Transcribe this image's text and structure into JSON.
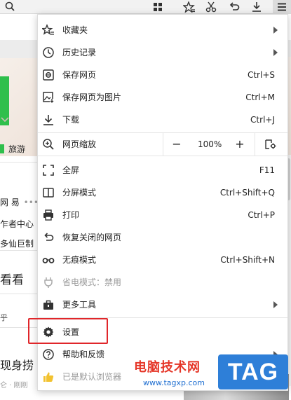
{
  "toolbar": {
    "icons": [
      "search-icon",
      "extensions-grid-icon",
      "bookmark-star-icon",
      "cut-icon",
      "undo-icon",
      "download-icon",
      "menu-icon"
    ]
  },
  "background_page": {
    "tag_travel": "旅游",
    "netease": "网 易",
    "netease_more": "•••",
    "author_center": "乍者中心",
    "line_4": "多仙巨制",
    "line_5": "看看",
    "tab_1": "乎",
    "tab_2": "财",
    "headline": "现身捞",
    "meta": "仑 · 刚刚"
  },
  "menu": {
    "items": [
      {
        "id": "favorites",
        "label": "收藏夹",
        "icon": "star-list-icon",
        "submenu": true
      },
      {
        "id": "history",
        "label": "历史记录",
        "icon": "clock-icon",
        "submenu": true
      },
      {
        "id": "save-page",
        "label": "保存网页",
        "icon": "save-page-icon",
        "shortcut": "Ctrl+S"
      },
      {
        "id": "save-as-image",
        "label": "保存网页为图片",
        "icon": "image-save-icon",
        "shortcut": "Ctrl+M"
      },
      {
        "id": "download",
        "label": "下载",
        "icon": "download-icon",
        "shortcut": "Ctrl+J"
      },
      {
        "id": "fullscreen",
        "label": "全屏",
        "icon": "fullscreen-icon",
        "shortcut": "F11"
      },
      {
        "id": "split-screen",
        "label": "分屏模式",
        "icon": "split-screen-icon",
        "shortcut": "Ctrl+Shift+Q"
      },
      {
        "id": "print",
        "label": "打印",
        "icon": "printer-icon",
        "shortcut": "Ctrl+P"
      },
      {
        "id": "restore-closed",
        "label": "恢复关闭的网页",
        "icon": "restore-icon"
      },
      {
        "id": "incognito",
        "label": "无痕模式",
        "icon": "incognito-icon",
        "shortcut": "Ctrl+Shift+N"
      },
      {
        "id": "power-saving",
        "label": "省电模式：禁用",
        "icon": "plug-icon",
        "disabled": true
      },
      {
        "id": "more-tools",
        "label": "更多工具",
        "icon": "toolbox-icon",
        "submenu": true
      },
      {
        "id": "settings",
        "label": "设置",
        "icon": "gear-icon",
        "highlighted": true
      },
      {
        "id": "help-feedback",
        "label": "帮助和反馈",
        "icon": "help-icon",
        "submenu": true
      },
      {
        "id": "default-browser",
        "label": "已是默认浏览器",
        "icon": "thumbs-up-icon",
        "disabled": true
      }
    ],
    "zoom": {
      "label": "网页缩放",
      "icon": "zoom-icon",
      "minus": "−",
      "value": "100%",
      "plus": "+",
      "settings_icon": "zoom-settings-icon"
    }
  },
  "watermark": {
    "site_name": "电脑技术网",
    "url": "www.tagxp.com",
    "tag": "TAG",
    "brand_color": "#2e7fd8",
    "text_color": "#e53628"
  },
  "colors": {
    "highlight_border": "#e0262a",
    "green_accent": "#2fbf4c",
    "disabled_text": "#9a9a9a"
  }
}
